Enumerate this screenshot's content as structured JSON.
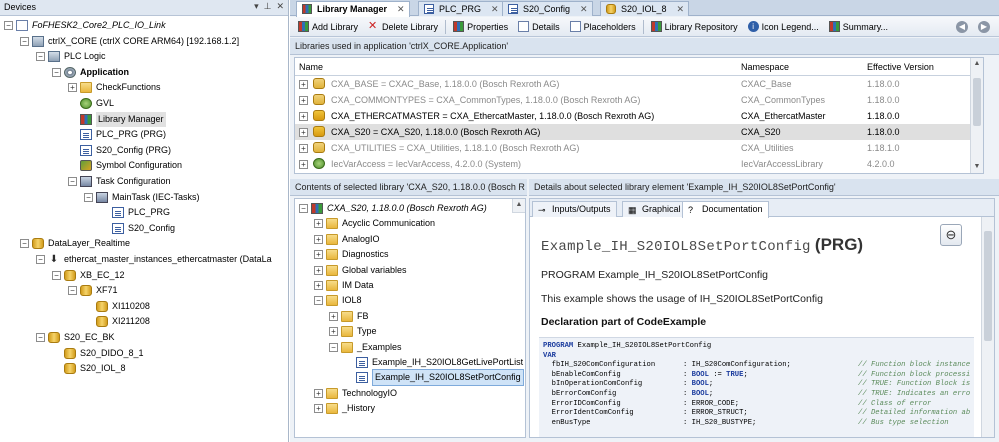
{
  "devices": {
    "title": "Devices",
    "tree": [
      {
        "label": "FoFHESK2_Core2_PLC_IO_Link",
        "icon": "project-icon",
        "level": 0,
        "exp": "-",
        "style": "ital"
      },
      {
        "label": "ctrlX_CORE (ctrlX CORE ARM64) [192.168.1.2]",
        "icon": "plc-icon",
        "level": 1,
        "exp": "-"
      },
      {
        "label": "PLC Logic",
        "icon": "plc-logic-icon",
        "level": 2,
        "exp": "-"
      },
      {
        "label": "Application",
        "icon": "application-gear-icon",
        "level": 3,
        "exp": "-",
        "style": "bold"
      },
      {
        "label": "CheckFunctions",
        "icon": "folder-icon",
        "level": 4,
        "exp": "+"
      },
      {
        "label": "GVL",
        "icon": "globe-icon",
        "level": 4,
        "exp": ""
      },
      {
        "label": "Library Manager",
        "icon": "library-icon",
        "level": 4,
        "exp": "",
        "sel": true
      },
      {
        "label": "PLC_PRG (PRG)",
        "icon": "pou-icon",
        "level": 4,
        "exp": ""
      },
      {
        "label": "S20_Config (PRG)",
        "icon": "pou-icon",
        "level": 4,
        "exp": ""
      },
      {
        "label": "Symbol Configuration",
        "icon": "symbol-config-icon",
        "level": 4,
        "exp": ""
      },
      {
        "label": "Task Configuration",
        "icon": "task-config-icon",
        "level": 4,
        "exp": "-"
      },
      {
        "label": "MainTask (IEC-Tasks)",
        "icon": "task-icon",
        "level": 5,
        "exp": "-"
      },
      {
        "label": "PLC_PRG",
        "icon": "pou-icon",
        "level": 6,
        "exp": ""
      },
      {
        "label": "S20_Config",
        "icon": "pou-icon",
        "level": 6,
        "exp": ""
      },
      {
        "label": "DataLayer_Realtime",
        "icon": "datalayer-icon",
        "level": 1,
        "exp": "-"
      },
      {
        "label": "ethercat_master_instances_ethercatmaster (DataLa",
        "icon": "arrow-down-icon",
        "level": 2,
        "exp": "-"
      },
      {
        "label": "XB_EC_12",
        "icon": "device-icon",
        "level": 3,
        "exp": "-"
      },
      {
        "label": "XF71",
        "icon": "device-icon",
        "level": 4,
        "exp": "-"
      },
      {
        "label": "XI110208",
        "icon": "device-icon",
        "level": 5,
        "exp": ""
      },
      {
        "label": "XI211208",
        "icon": "device-icon",
        "level": 5,
        "exp": ""
      },
      {
        "label": "S20_EC_BK",
        "icon": "device-icon",
        "level": 2,
        "exp": "-"
      },
      {
        "label": "S20_DIDO_8_1",
        "icon": "device-icon",
        "level": 3,
        "exp": ""
      },
      {
        "label": "S20_IOL_8",
        "icon": "device-icon",
        "level": 3,
        "exp": ""
      }
    ]
  },
  "tabs": [
    {
      "label": "Library Manager",
      "active": true,
      "icon": "library-icon"
    },
    {
      "label": "PLC_PRG",
      "icon": "pou-icon"
    },
    {
      "label": "S20_Config",
      "icon": "pou-icon"
    },
    {
      "label": "S20_IOL_8",
      "icon": "device-icon"
    }
  ],
  "toolbar": {
    "add_library": "Add Library",
    "delete_library": "Delete Library",
    "properties": "Properties",
    "details": "Details",
    "placeholders": "Placeholders",
    "library_repository": "Library Repository",
    "icon_legend": "Icon Legend...",
    "summary": "Summary..."
  },
  "libraries": {
    "header": "Libraries used in application 'ctrlX_CORE.Application'",
    "columns": {
      "name": "Name",
      "namespace": "Namespace",
      "version": "Effective Version"
    },
    "rows": [
      {
        "name": "CXA_BASE = CXAC_Base, 1.18.0.0 (Bosch Rexroth AG)",
        "namespace": "CXAC_Base",
        "version": "1.18.0.0",
        "grey": true
      },
      {
        "name": "CXA_COMMONTYPES = CXA_CommonTypes, 1.18.0.0 (Bosch Rexroth AG)",
        "namespace": "CXA_CommonTypes",
        "version": "1.18.0.0",
        "grey": true
      },
      {
        "name": "CXA_ETHERCATMASTER = CXA_EthercatMaster, 1.18.0.0 (Bosch Rexroth AG)",
        "namespace": "CXA_EthercatMaster",
        "version": "1.18.0.0",
        "grey": false
      },
      {
        "name": "CXA_S20 = CXA_S20, 1.18.0.0 (Bosch Rexroth AG)",
        "namespace": "CXA_S20",
        "version": "1.18.0.0",
        "grey": false,
        "sel": true
      },
      {
        "name": "CXA_UTILITIES = CXA_Utilities, 1.18.1.0 (Bosch Rexroth AG)",
        "namespace": "CXA_Utilities",
        "version": "1.18.1.0",
        "grey": true
      },
      {
        "name": "IecVarAccess = IecVarAccess, 4.2.0.0 (System)",
        "namespace": "IecVarAccessLibrary",
        "version": "4.2.0.0",
        "grey": true
      }
    ]
  },
  "contents": {
    "header": "Contents of selected library 'CXA_S20, 1.18.0.0 (Bosch R",
    "tree": [
      {
        "label": "CXA_S20, 1.18.0.0 (Bosch Rexroth AG)",
        "icon": "library-icon",
        "level": 0,
        "exp": "-",
        "style": "ital"
      },
      {
        "label": "Acyclic Communication",
        "icon": "folder-icon",
        "level": 1,
        "exp": "+"
      },
      {
        "label": "AnalogIO",
        "icon": "folder-icon",
        "level": 1,
        "exp": "+"
      },
      {
        "label": "Diagnostics",
        "icon": "folder-icon",
        "level": 1,
        "exp": "+"
      },
      {
        "label": "Global variables",
        "icon": "folder-icon",
        "level": 1,
        "exp": "+"
      },
      {
        "label": "IM Data",
        "icon": "folder-icon",
        "level": 1,
        "exp": "+"
      },
      {
        "label": "IOL8",
        "icon": "folder-icon",
        "level": 1,
        "exp": "-"
      },
      {
        "label": "FB",
        "icon": "folder-icon",
        "level": 2,
        "exp": "+"
      },
      {
        "label": "Type",
        "icon": "folder-icon",
        "level": 2,
        "exp": "+"
      },
      {
        "label": "_Examples",
        "icon": "folder-icon",
        "level": 2,
        "exp": "-"
      },
      {
        "label": "Example_IH_S20IOL8GetLivePortList",
        "icon": "pou-icon",
        "level": 3,
        "exp": ""
      },
      {
        "label": "Example_IH_S20IOL8SetPortConfig",
        "icon": "pou-icon",
        "level": 3,
        "exp": "",
        "sel": true
      },
      {
        "label": "TechnologyIO",
        "icon": "folder-icon",
        "level": 1,
        "exp": "+"
      },
      {
        "label": "_History",
        "icon": "folder-icon",
        "level": 1,
        "exp": "+"
      }
    ]
  },
  "details": {
    "header": "Details about selected library element 'Example_IH_S20IOL8SetPortConfig'",
    "tabs": [
      {
        "label": "Inputs/Outputs",
        "icon": "inputs-outputs-icon"
      },
      {
        "label": "Graphical",
        "icon": "graphical-icon"
      },
      {
        "label": "Documentation",
        "icon": "documentation-icon",
        "active": true
      }
    ],
    "doc_title": "Example_IH_S20IOL8SetPortConfig",
    "doc_kind": "(PRG)",
    "program_line": "PROGRAM Example_IH_S20IOL8SetPortConfig",
    "usage_line": "This example shows the usage of IH_S20IOL8SetPortConfig",
    "decl_heading": "Declaration part of CodeExample",
    "code": [
      {
        "kw": "PROGRAM",
        "rest": " Example_IH_S20IOL8SetPortConfig"
      },
      {
        "kw": "VAR",
        "rest": ""
      },
      {
        "var": "  fbIH_S20ComConfiguration",
        "type": ": IH_S20ComConfiguration;",
        "cmt": "// Function block instance"
      },
      {
        "var": "  bEnableComConfig",
        "type": ": BOOL := TRUE;",
        "cmt": "// Function block processi"
      },
      {
        "var": "  bInOperationComConfig",
        "type": ": BOOL;",
        "cmt": "// TRUE: Function Block is"
      },
      {
        "var": "  bErrorComConfig",
        "type": ": BOOL;",
        "cmt": "// TRUE: Indicates an erro"
      },
      {
        "var": "  ErrorIDComConfig",
        "type": ": ERROR_CODE;",
        "cmt": "// Class of error"
      },
      {
        "var": "  ErrorIdentComConfig",
        "type": ": ERROR_STRUCT;",
        "cmt": "// Detailed information ab"
      },
      {
        "var": "  enBusType",
        "type": ": IH_S20_BUSTYPE;",
        "cmt": "// Bus type selection"
      }
    ]
  }
}
